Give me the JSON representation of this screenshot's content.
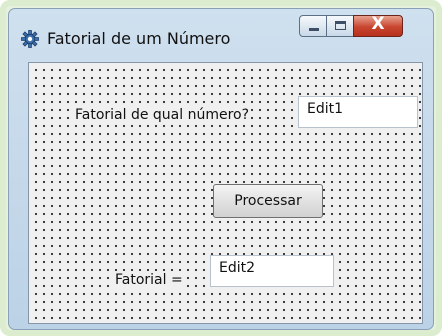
{
  "window": {
    "title": "Fatorial de um Número",
    "icon": "gear-icon",
    "controls": {
      "minimize": "minimize-icon",
      "maximize": "maximize-icon",
      "close_label": "X"
    }
  },
  "form": {
    "question_label": "Fatorial de qual número?",
    "input_number": "Edit1",
    "process_button": "Processar",
    "result_label": "Fatorial =",
    "output_result": "Edit2"
  },
  "colors": {
    "close_button": "#c8452f",
    "titlebar": "#cfe0ef",
    "form_background": "#f0f0f0"
  }
}
